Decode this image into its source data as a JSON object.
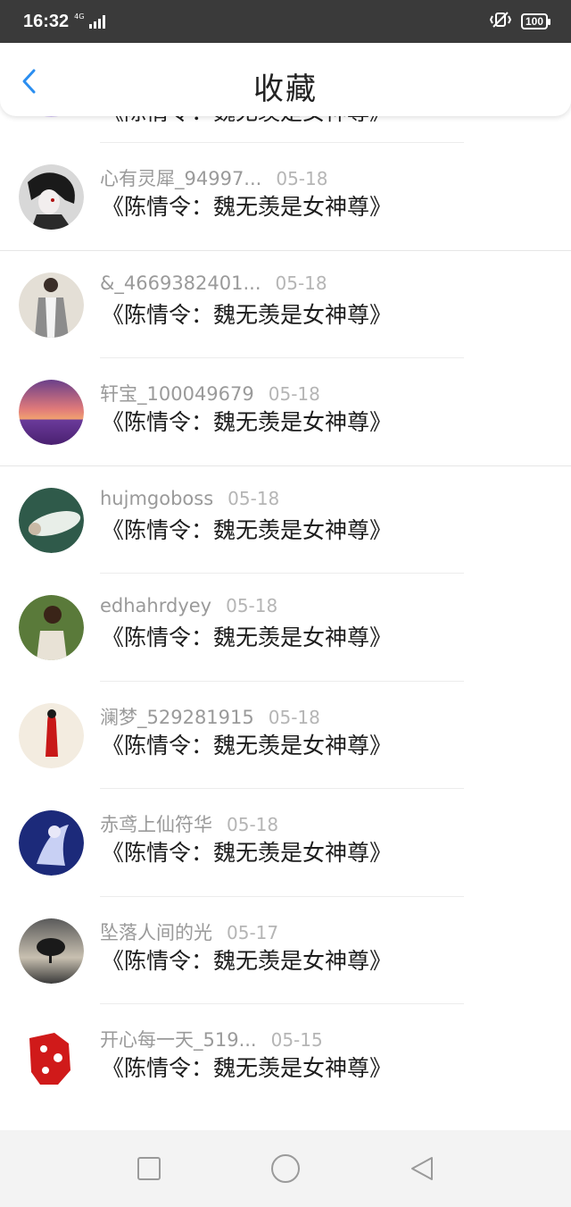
{
  "status": {
    "time": "16:32",
    "network": "4G",
    "battery": "100"
  },
  "header": {
    "title": "收藏"
  },
  "items": [
    {
      "user": "",
      "date": "",
      "text": "《陈情令：魏无羡是女神尊》",
      "avatar": "purple-chat-bubble"
    },
    {
      "user": "心有灵犀_94997...",
      "date": "05-18",
      "text": "《陈情令：魏无羡是女神尊》",
      "avatar": "dark-haired-figure"
    },
    {
      "user": "&_4669382401...",
      "date": "05-18",
      "text": "《陈情令：魏无羡是女神尊》",
      "avatar": "person-grey-coat"
    },
    {
      "user": "轩宝_100049679",
      "date": "05-18",
      "text": "《陈情令：魏无羡是女神尊》",
      "avatar": "lavender-sunset"
    },
    {
      "user": "hujmgoboss",
      "date": "05-18",
      "text": "《陈情令：魏无羡是女神尊》",
      "avatar": "reclining-figure"
    },
    {
      "user": "edhahrdyey",
      "date": "05-18",
      "text": "《陈情令：魏无羡是女神尊》",
      "avatar": "person-greenery"
    },
    {
      "user": "澜梦_529281915",
      "date": "05-18",
      "text": "《陈情令：魏无羡是女神尊》",
      "avatar": "red-robed-lady"
    },
    {
      "user": "赤鸢上仙符华",
      "date": "05-18",
      "text": "《陈情令：魏无羡是女神尊》",
      "avatar": "anime-blue"
    },
    {
      "user": "坠落人间的光",
      "date": "05-17",
      "text": "《陈情令：魏无羡是女神尊》",
      "avatar": "tree-silhouette"
    },
    {
      "user": "开心每一天_519...",
      "date": "05-15",
      "text": "《陈情令：魏无羡是女神尊》",
      "avatar": "red-papercut"
    }
  ],
  "colors": {
    "status_bg": "#3a3a3a",
    "accent": "#2b8ef0",
    "username": "#9a9a9a",
    "date": "#b5b5b5",
    "body_text": "#1d1d1d"
  }
}
